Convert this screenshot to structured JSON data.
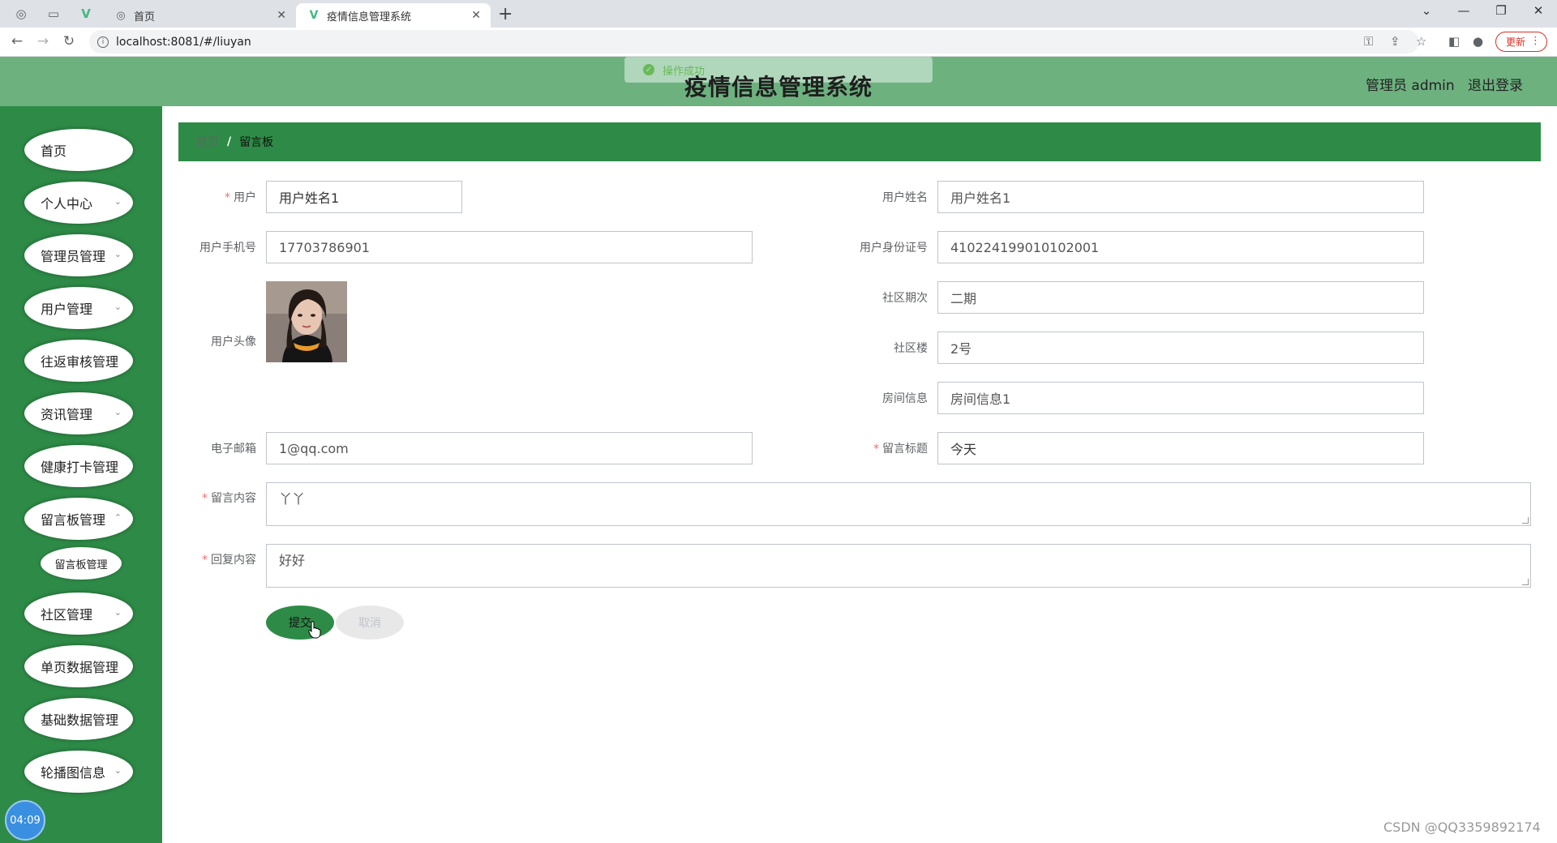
{
  "browser": {
    "tabs": [
      {
        "title": "首页",
        "active": false
      },
      {
        "title": "疫情信息管理系统",
        "active": true
      }
    ],
    "url": "localhost:8081/#/liuyan",
    "update_label": "更新"
  },
  "header": {
    "title": "疫情信息管理系统",
    "toast": "操作成功",
    "user_label": "管理员 admin",
    "logout_label": "退出登录"
  },
  "sidebar": {
    "items": [
      {
        "label": "首页",
        "has_children": false
      },
      {
        "label": "个人中心",
        "has_children": true
      },
      {
        "label": "管理员管理",
        "has_children": true
      },
      {
        "label": "用户管理",
        "has_children": true
      },
      {
        "label": "往返审核管理",
        "has_children": false
      },
      {
        "label": "资讯管理",
        "has_children": true
      },
      {
        "label": "健康打卡管理",
        "has_children": false
      },
      {
        "label": "留言板管理",
        "has_children": true
      },
      {
        "label": "社区管理",
        "has_children": true
      },
      {
        "label": "单页数据管理",
        "has_children": false
      },
      {
        "label": "基础数据管理",
        "has_children": false
      },
      {
        "label": "轮播图信息",
        "has_children": true
      }
    ],
    "submenu": {
      "label": "留言板管理"
    },
    "clock": "04:09"
  },
  "breadcrumb": {
    "home": "首页",
    "separator": "/",
    "current": "留言板"
  },
  "form": {
    "user": {
      "label": "用户",
      "required": true,
      "value": "用户姓名1"
    },
    "user_name": {
      "label": "用户姓名",
      "value": "用户姓名1"
    },
    "phone": {
      "label": "用户手机号",
      "value": "17703786901"
    },
    "id_card": {
      "label": "用户身份证号",
      "value": "410224199010102001"
    },
    "avatar": {
      "label": "用户头像"
    },
    "community_phase": {
      "label": "社区期次",
      "value": "二期"
    },
    "building": {
      "label": "社区楼",
      "value": "2号"
    },
    "room": {
      "label": "房间信息",
      "value": "房间信息1"
    },
    "email": {
      "label": "电子邮箱",
      "value": "1@qq.com"
    },
    "msg_title": {
      "label": "留言标题",
      "required": true,
      "value": "今天"
    },
    "msg_content": {
      "label": "留言内容",
      "required": true,
      "value": "丫丫"
    },
    "reply_content": {
      "label": "回复内容",
      "required": true,
      "value": "好好"
    },
    "submit_label": "提交",
    "cancel_label": "取消"
  },
  "watermark": "CSDN @QQ3359892174",
  "colors": {
    "primary_green": "#2e8b47",
    "header_green": "#6db17f",
    "required_star": "#f56c6c"
  }
}
